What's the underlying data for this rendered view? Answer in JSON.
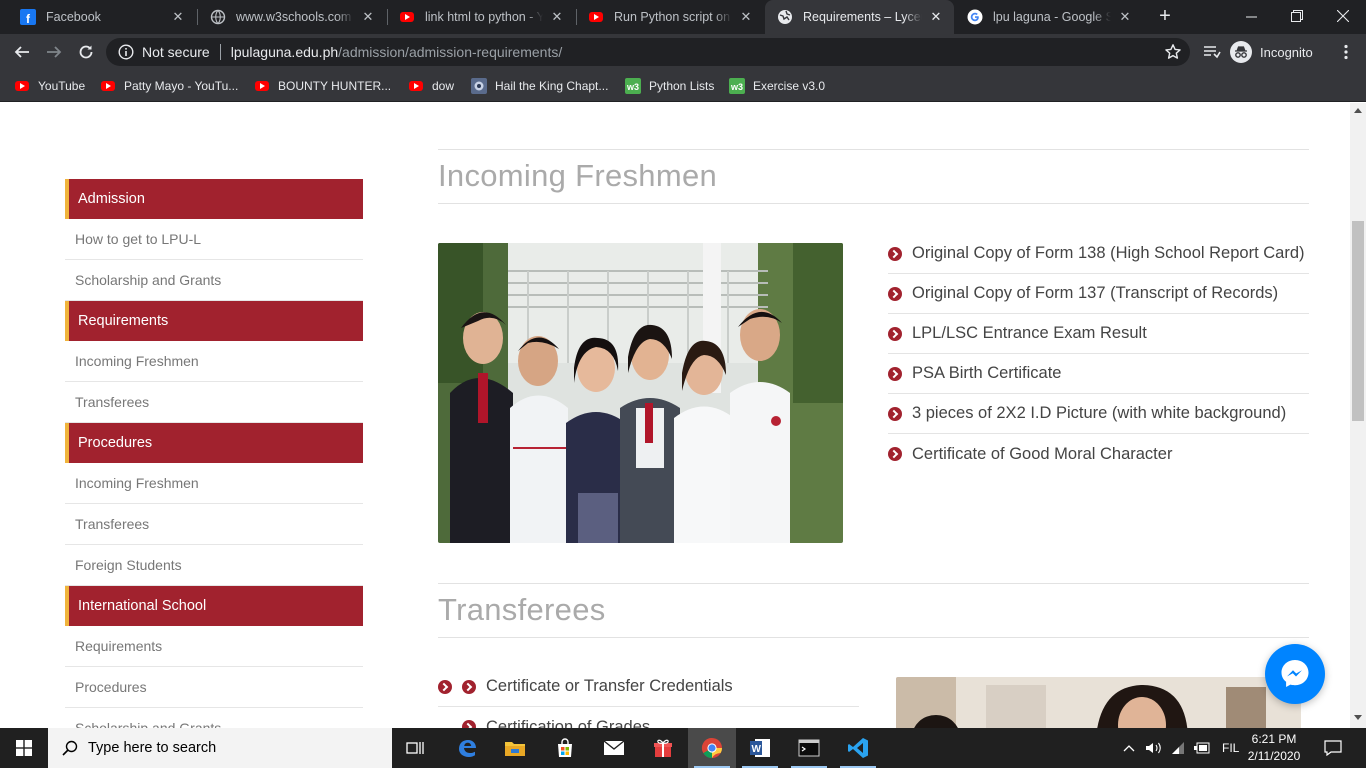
{
  "browser": {
    "tabs": [
      {
        "label": "Facebook",
        "icon": "facebook-icon"
      },
      {
        "label": "www.w3schools.com",
        "icon": "globe-icon"
      },
      {
        "label": "link html to python - Yo",
        "icon": "youtube-icon"
      },
      {
        "label": "Run Python script on cli",
        "icon": "youtube-icon"
      },
      {
        "label": "Requirements – Lyceum",
        "icon": "globe-icon",
        "active": true
      },
      {
        "label": "lpu laguna - Google Sea",
        "icon": "google-icon"
      }
    ],
    "close_glyph": "✕",
    "new_tab_glyph": "+",
    "address": {
      "status": "Not secure",
      "host": "lpulaguna.edu.ph",
      "path": "/admission/admission-requirements/"
    },
    "profile_label": "Incognito",
    "bookmarks": [
      {
        "label": "YouTube",
        "icon": "youtube-icon"
      },
      {
        "label": "Patty Mayo - YouTu...",
        "icon": "youtube-icon"
      },
      {
        "label": "BOUNTY HUNTER...",
        "icon": "youtube-icon"
      },
      {
        "label": "dow",
        "icon": "youtube-icon"
      },
      {
        "label": "Hail the King Chapt...",
        "icon": "book-icon"
      },
      {
        "label": "Python Lists",
        "icon": "w3-icon"
      },
      {
        "label": "Exercise v3.0",
        "icon": "w3-icon"
      }
    ]
  },
  "sidebar": {
    "groups": [
      {
        "heading": "Admission",
        "items": [
          "How to get to LPU-L",
          "Scholarship and Grants"
        ]
      },
      {
        "heading": "Requirements",
        "items": [
          "Incoming Freshmen",
          "Transferees"
        ]
      },
      {
        "heading": "Procedures",
        "items": [
          "Incoming Freshmen",
          "Transferees",
          "Foreign Students"
        ]
      },
      {
        "heading": "International School",
        "items": [
          "Requirements",
          "Procedures",
          "Scholarship and Grants"
        ]
      }
    ]
  },
  "main": {
    "freshmen": {
      "title": "Incoming Freshmen",
      "requirements": [
        "Original Copy of Form 138 (High School Report Card)",
        "Original Copy of Form 137 (Transcript of Records)",
        "LPL/LSC Entrance Exam Result",
        "PSA Birth Certificate",
        "3 pieces of 2X2 I.D Picture (with white background)",
        "Certificate of Good Moral Character"
      ]
    },
    "transferees": {
      "title": "Transferees",
      "requirements": [
        "Certificate or Transfer Credentials",
        "Certification of Grades"
      ]
    }
  },
  "taskbar": {
    "search_placeholder": "Type here to search",
    "language": "FIL",
    "time": "6:21 PM",
    "date": "2/11/2020"
  },
  "colors": {
    "brand_red": "#a1222e",
    "brand_gold": "#f0b43c",
    "messenger_blue": "#0084ff"
  }
}
